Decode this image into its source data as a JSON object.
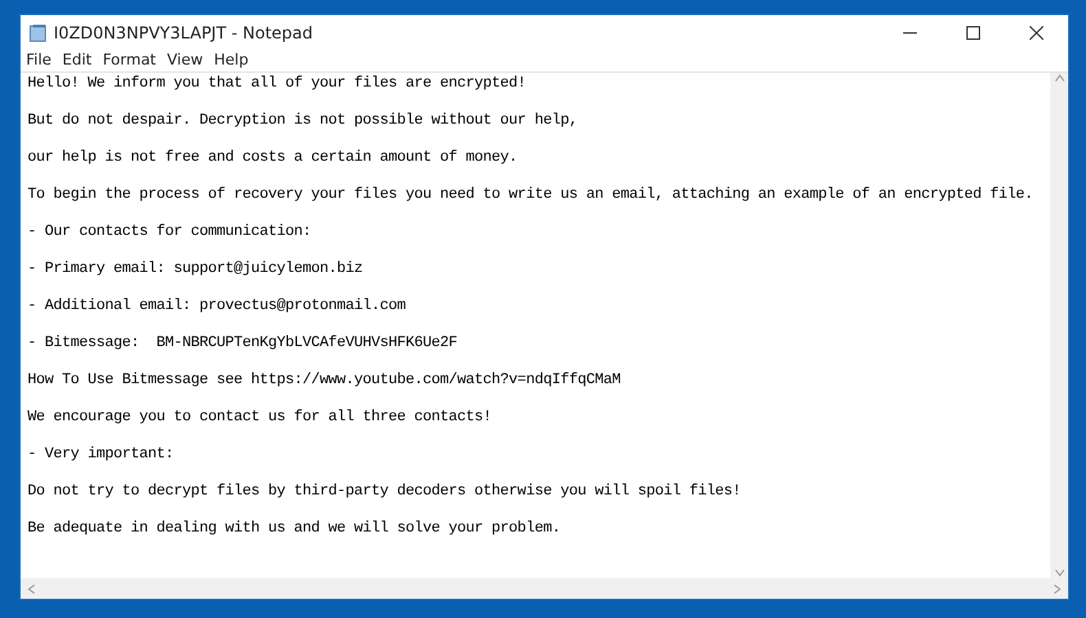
{
  "window": {
    "title": "I0ZD0N3NPVY3LAPJT - Notepad"
  },
  "menu": [
    "File",
    "Edit",
    "Format",
    "View",
    "Help"
  ],
  "document_lines": [
    "Hello! We inform you that all of your files are encrypted!",
    "But do not despair. Decryption is not possible without our help,",
    "our help is not free and costs a certain amount of money.",
    "To begin the process of recovery your files you need to write us an email, attaching an example of an encrypted file.",
    "- Our contacts for communication:",
    "- Primary email: support@juicylemon.biz",
    "- Additional email: provectus@protonmail.com",
    "- Bitmessage:  BM-NBRCUPTenKgYbLVCAfeVUHVsHFK6Ue2F",
    "How To Use Bitmessage see https://www.youtube.com/watch?v=ndqIffqCMaM",
    "We encourage you to contact us for all three contacts!",
    "- Very important:",
    "Do not try to decrypt files by third-party decoders otherwise you will spoil files!",
    "Be adequate in dealing with us and we will solve your problem."
  ]
}
